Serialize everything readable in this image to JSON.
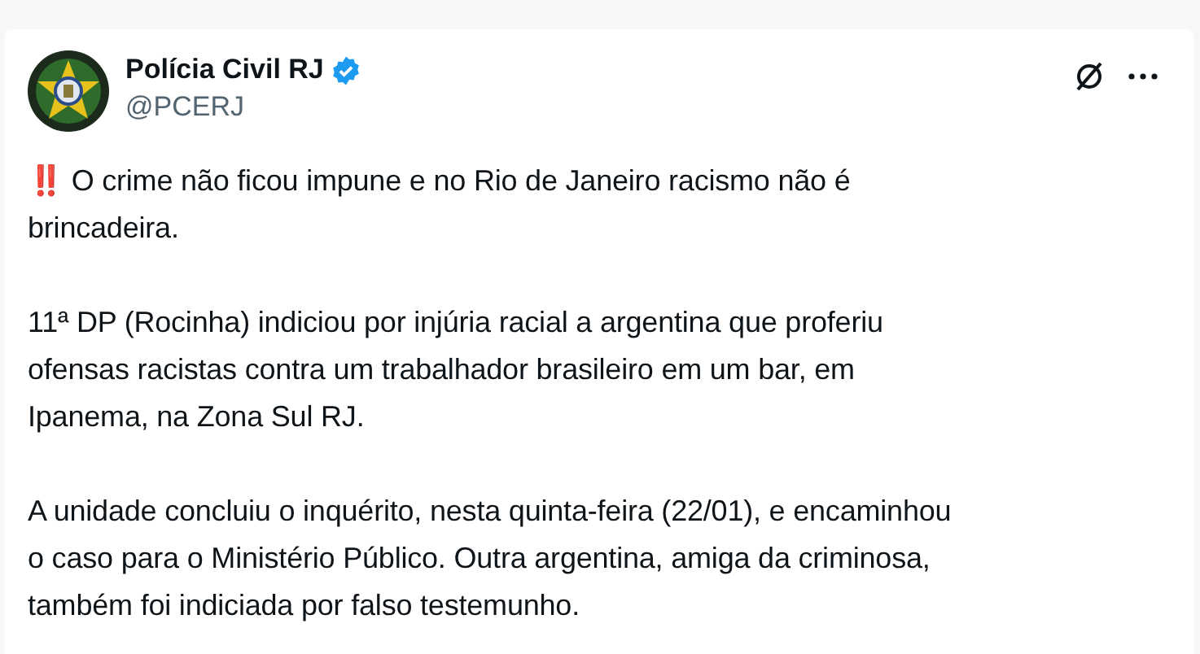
{
  "account": {
    "name": "Polícia Civil RJ",
    "verified": true,
    "handle": "@PCERJ"
  },
  "paragraphs": [
    {
      "lead": "‼️",
      "lines": [
        "O crime não ficou impune e no Rio de Janeiro racismo não é",
        "brincadeira."
      ]
    },
    {
      "lines": [
        "11ª DP (Rocinha) indiciou por injúria racial a argentina que proferiu",
        "ofensas racistas contra um trabalhador brasileiro em um bar, em",
        "Ipanema, na Zona Sul RJ."
      ]
    },
    {
      "lines": [
        "A unidade concluiu o inquérito, nesta quinta-feira (22/01), e encaminhou",
        "o caso para o Ministério Público. Outra argentina, amiga da criminosa,",
        "também foi indiciada por falso testemunho."
      ]
    }
  ]
}
